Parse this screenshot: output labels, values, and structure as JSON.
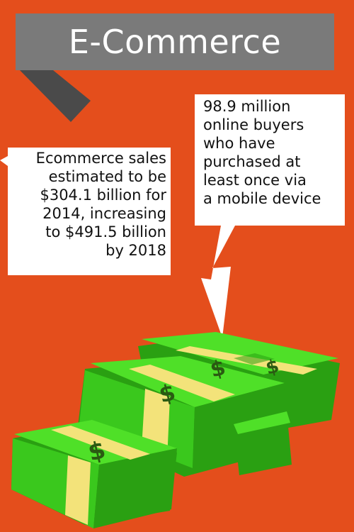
{
  "title": "E-Commerce",
  "callout_left": {
    "lines": [
      "Ecommerce sales",
      "estimated to be",
      "$304.1 billion for",
      "2014, increasing",
      "to $491.5 billion",
      "by 2018"
    ]
  },
  "callout_right": {
    "lines": [
      "98.9 million",
      "online buyers",
      "who have",
      "purchased at",
      "least once via",
      "a mobile device"
    ]
  },
  "colors": {
    "background": "#e44e1c",
    "banner": "#7a7a7a",
    "banner_fold": "#4a4a4a",
    "cash_light": "#4fe028",
    "cash_dark": "#2aa012",
    "band": "#f3e37a"
  },
  "illustration": {
    "icon": "money-stacks-icon",
    "symbol": "$"
  }
}
